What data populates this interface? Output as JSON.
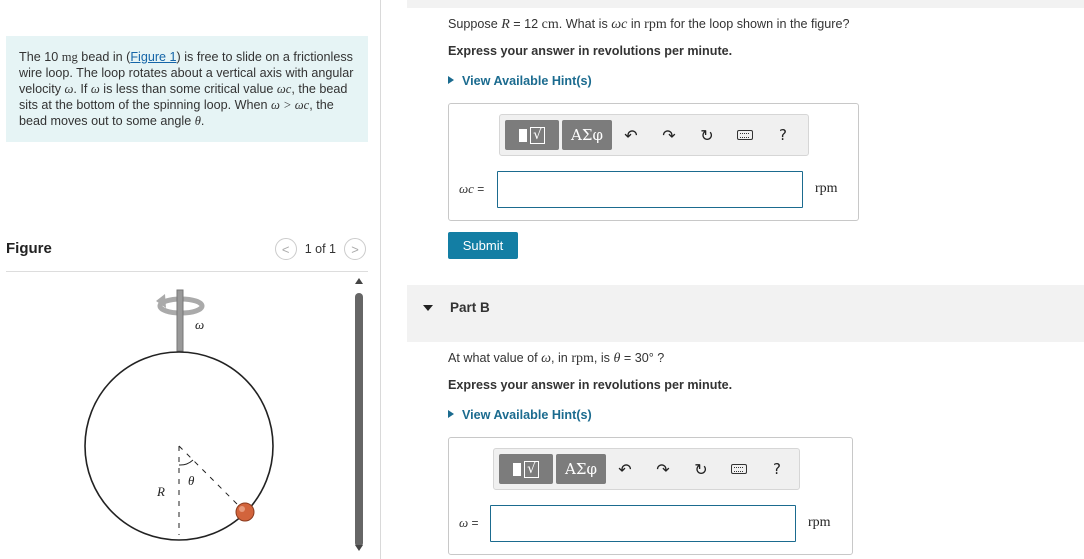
{
  "problem": {
    "p1": "The 10 ",
    "mg": "mg",
    "p2": " bead in (",
    "figure_link": "Figure 1",
    "p3": ") is free to slide on a frictionless wire loop. The loop rotates about a vertical axis with angular velocity ",
    "omega": "ω",
    "p4": ". If ",
    "p5": " is less than some critical value ",
    "omega_c": "ωc",
    "p6": ", the bead sits at the bottom of the spinning loop. When ",
    "cmp": " ω > ωc",
    "p7": ", the bead moves out to some angle ",
    "theta": "θ",
    "p8": "."
  },
  "figure_panel": {
    "title": "Figure",
    "pager": "1 of 1",
    "prev": "<",
    "next": ">",
    "omega_label": "ω",
    "theta_label": "θ",
    "r_label": "R"
  },
  "part_a": {
    "q1": "Suppose ",
    "R": "R",
    "q2": " = 12 ",
    "cm": "cm",
    "q3": ". What is ",
    "wc": "ωc",
    "q4": " in ",
    "rpm": "rpm",
    "q5": " for the loop shown in the figure?",
    "instruction": "Express your answer in revolutions per minute.",
    "hint": "View Available Hint(s)",
    "label": "ωc",
    "eq": " =",
    "input_value": "",
    "unit": "rpm",
    "submit": "Submit"
  },
  "part_b": {
    "title": "Part B",
    "q1": "At what value of ",
    "w": "ω",
    "q2": ", in ",
    "rpm": "rpm",
    "q3": ", is ",
    "theta": "θ",
    "q4": " = 30° ?",
    "instruction": "Express your answer in revolutions per minute.",
    "hint": "View Available Hint(s)",
    "label": "ω",
    "eq": " =",
    "input_value": "",
    "unit": "rpm"
  },
  "toolbar": {
    "sqrt_symbol": "√",
    "greek": "ΑΣφ",
    "undo_icon": "undo-icon",
    "redo_icon": "redo-icon",
    "reset_icon": "reset-icon",
    "keyboard_icon": "keyboard-icon",
    "help": "?"
  },
  "colors": {
    "accent": "#137ea4",
    "problem_bg": "#e6f4f5",
    "bead": "#d2643c"
  }
}
